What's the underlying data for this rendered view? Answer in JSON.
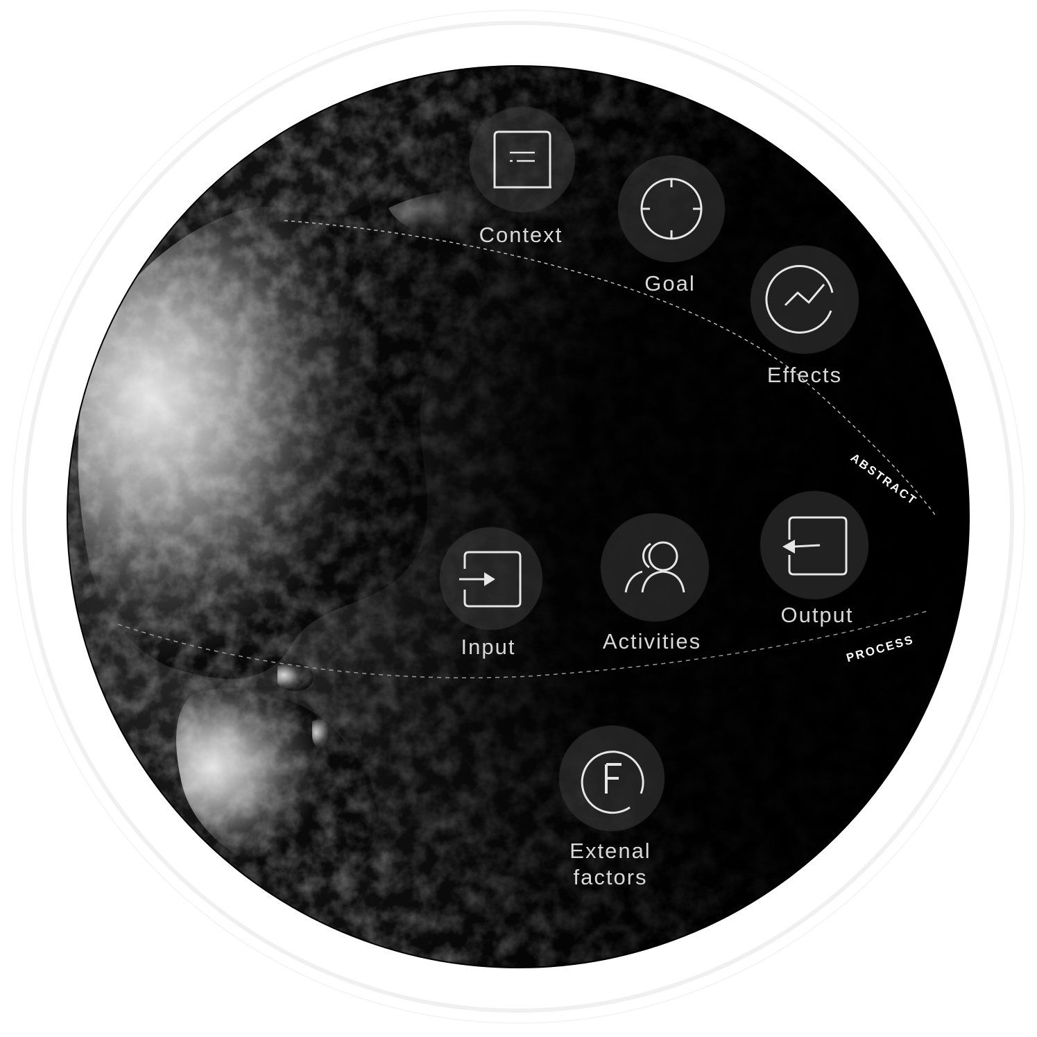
{
  "diagram": {
    "nodes": [
      {
        "id": "context",
        "label": "Context",
        "icon": "document-lines-icon"
      },
      {
        "id": "goal",
        "label": "Goal",
        "icon": "crosshair-icon"
      },
      {
        "id": "effects",
        "label": "Effects",
        "icon": "trend-chart-icon"
      },
      {
        "id": "input",
        "label": "Input",
        "icon": "sign-in-arrow-icon"
      },
      {
        "id": "activities",
        "label": "Activities",
        "icon": "users-icon"
      },
      {
        "id": "output",
        "label": "Output",
        "icon": "sign-out-arrow-icon"
      },
      {
        "id": "external",
        "label_line1": "Extenal",
        "label_line2": "factors",
        "icon": "letter-f-circle-icon"
      }
    ],
    "bands": {
      "abstract": "ABSTRACT",
      "process": "PROCESS"
    }
  },
  "colors": {
    "globe_dark": "#050505",
    "land_light": "#d8d8d8",
    "node_disc": "#3a3a3a",
    "icon_stroke": "#e6e6e6",
    "ring": "#eeeeee"
  }
}
